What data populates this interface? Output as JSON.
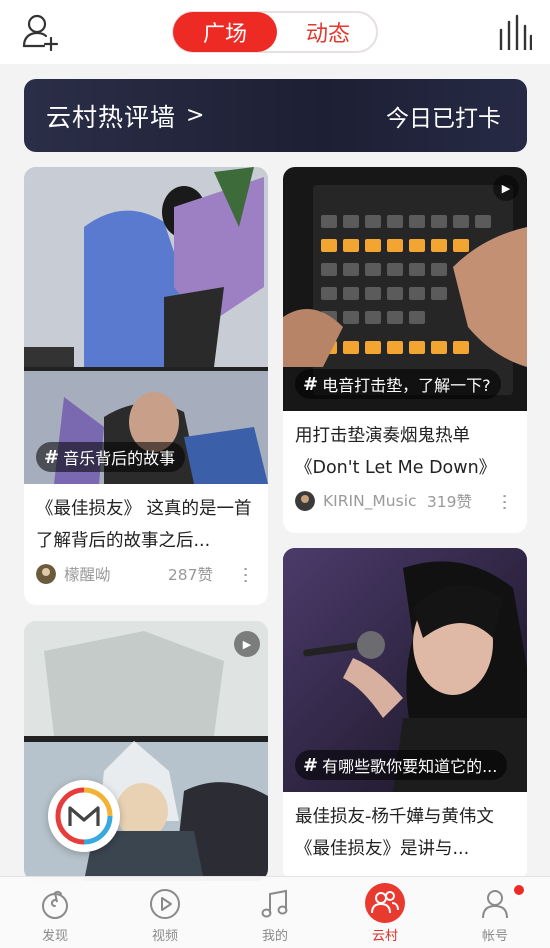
{
  "header": {
    "tabs": [
      {
        "label": "广场",
        "active": true
      },
      {
        "label": "动态",
        "active": false
      }
    ],
    "left_icon": "add-friend-icon",
    "right_icon": "bar-chart-icon"
  },
  "banner": {
    "title": "云村热评墙",
    "chevron": ">",
    "action": "今日已打卡"
  },
  "feed": {
    "cards": [
      {
        "tag": "音乐背后的故事",
        "desc": "《最佳损友》 这真的是一首了解背后的故事之后...",
        "user": "檬醒呦",
        "likes": "287赞"
      },
      {
        "tag": "电音打击垫，了解一下?",
        "desc": "用打击垫演奏烟鬼热单《Don't Let Me Down》",
        "user": "KIRIN_Music",
        "likes": "319赞",
        "video": true
      },
      {
        "tag": "",
        "video": true
      },
      {
        "tag": "有哪些歌你要知道它的...",
        "desc": "最佳损友-杨千嬅与黄伟文 《最佳损友》是讲与..."
      }
    ]
  },
  "tabbar": {
    "items": [
      {
        "label": "发现",
        "icon": "netease-music-icon"
      },
      {
        "label": "视频",
        "icon": "video-play-icon"
      },
      {
        "label": "我的",
        "icon": "music-note-icon"
      },
      {
        "label": "云村",
        "icon": "friends-icon",
        "active": true
      },
      {
        "label": "帐号",
        "icon": "account-icon",
        "badge": true
      }
    ]
  },
  "colors": {
    "accent": "#ee2a24",
    "banner_bg": "#1d1f34"
  }
}
